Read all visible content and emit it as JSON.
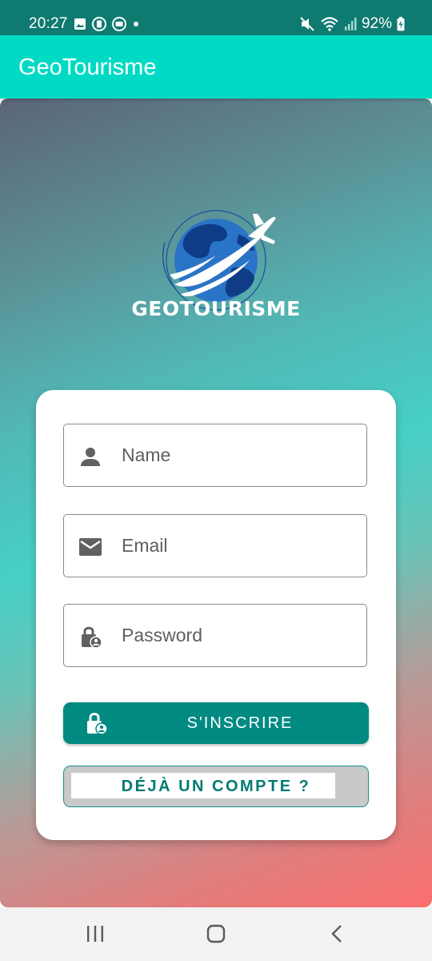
{
  "status_bar": {
    "time": "20:27",
    "battery": "92%",
    "icons": [
      "image-notification-icon",
      "app-notification-icon",
      "app-notification-icon",
      "dot-icon",
      "mute-icon",
      "wifi-icon",
      "signal-icon",
      "battery-charging-icon"
    ]
  },
  "app_bar": {
    "title": "GeoTourisme"
  },
  "logo": {
    "text": "GEOTOURISME"
  },
  "form": {
    "name_placeholder": "Name",
    "email_placeholder": "Email",
    "password_placeholder": "Password",
    "register_label": "S'INSCRIRE",
    "login_label": "DÉJÀ UN COMPTE ?"
  },
  "nav_bar": {
    "buttons": [
      "recents-icon",
      "home-icon",
      "back-icon"
    ]
  },
  "colors": {
    "app_bar": "#00dac5",
    "status_bar": "#0f7a70",
    "primary_button": "#008a82",
    "gradient_top": "#5b6577",
    "gradient_mid": "#46d0c6",
    "gradient_bottom": "#fb6f6d"
  }
}
